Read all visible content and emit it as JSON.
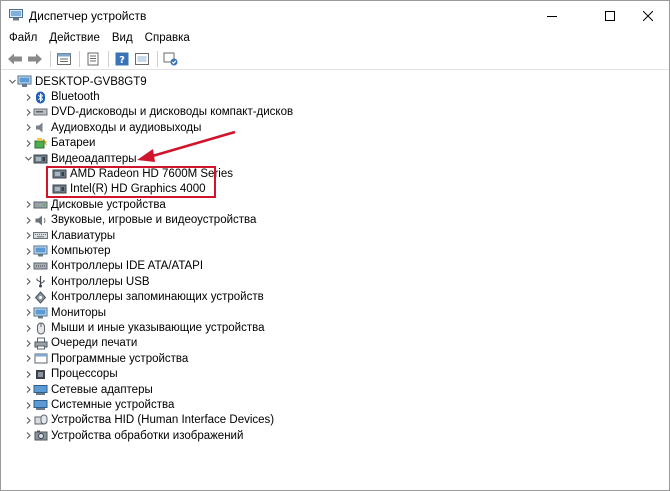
{
  "window": {
    "title": "Диспетчер устройств",
    "icon": "device-manager-icon"
  },
  "menu": [
    "Файл",
    "Действие",
    "Вид",
    "Справка"
  ],
  "toolbar": {
    "icons": [
      "back-arrow-icon",
      "forward-arrow-icon",
      "properties-icon",
      "scan-icon",
      "help-icon",
      "show-hidden-icon",
      "update-driver-icon"
    ]
  },
  "tree": {
    "root": {
      "label": "DESKTOP-GVB8GT9",
      "icon": "computer-icon"
    },
    "items": [
      {
        "label": "Bluetooth",
        "icon": "bluetooth-icon",
        "expanded": false
      },
      {
        "label": "DVD-дисководы и дисководы компакт-дисков",
        "icon": "dvd-drive-icon",
        "expanded": false
      },
      {
        "label": "Аудиовходы и аудиовыходы",
        "icon": "audio-io-icon",
        "expanded": false
      },
      {
        "label": "Батареи",
        "icon": "battery-icon",
        "expanded": false
      },
      {
        "label": "Видеоадаптеры",
        "icon": "display-adapter-icon",
        "expanded": true,
        "children": [
          {
            "label": "AMD Radeon HD 7600M Series",
            "icon": "gpu-icon"
          },
          {
            "label": "Intel(R) HD Graphics 4000",
            "icon": "gpu-icon"
          }
        ]
      },
      {
        "label": "Дисковые устройства",
        "icon": "disk-drive-icon",
        "expanded": false
      },
      {
        "label": "Звуковые, игровые и видеоустройства",
        "icon": "sound-icon",
        "expanded": false
      },
      {
        "label": "Клавиатуры",
        "icon": "keyboard-icon",
        "expanded": false
      },
      {
        "label": "Компьютер",
        "icon": "monitor-icon",
        "expanded": false
      },
      {
        "label": "Контроллеры IDE ATA/ATAPI",
        "icon": "ide-controller-icon",
        "expanded": false
      },
      {
        "label": "Контроллеры USB",
        "icon": "usb-icon",
        "expanded": false
      },
      {
        "label": "Контроллеры запоминающих устройств",
        "icon": "storage-controller-icon",
        "expanded": false
      },
      {
        "label": "Мониторы",
        "icon": "monitor-icon",
        "expanded": false
      },
      {
        "label": "Мыши и иные указывающие устройства",
        "icon": "mouse-icon",
        "expanded": false
      },
      {
        "label": "Очереди печати",
        "icon": "printer-icon",
        "expanded": false
      },
      {
        "label": "Программные устройства",
        "icon": "software-device-icon",
        "expanded": false
      },
      {
        "label": "Процессоры",
        "icon": "processor-icon",
        "expanded": false
      },
      {
        "label": "Сетевые адаптеры",
        "icon": "network-adapter-icon",
        "expanded": false
      },
      {
        "label": "Системные устройства",
        "icon": "system-device-icon",
        "expanded": false
      },
      {
        "label": "Устройства HID (Human Interface Devices)",
        "icon": "hid-icon",
        "expanded": false
      },
      {
        "label": "Устройства обработки изображений",
        "icon": "imaging-device-icon",
        "expanded": false
      }
    ]
  },
  "colors": {
    "highlight_box": "#d0142c",
    "arrow": "#d0142c",
    "chevron": "#5a5a5a"
  }
}
